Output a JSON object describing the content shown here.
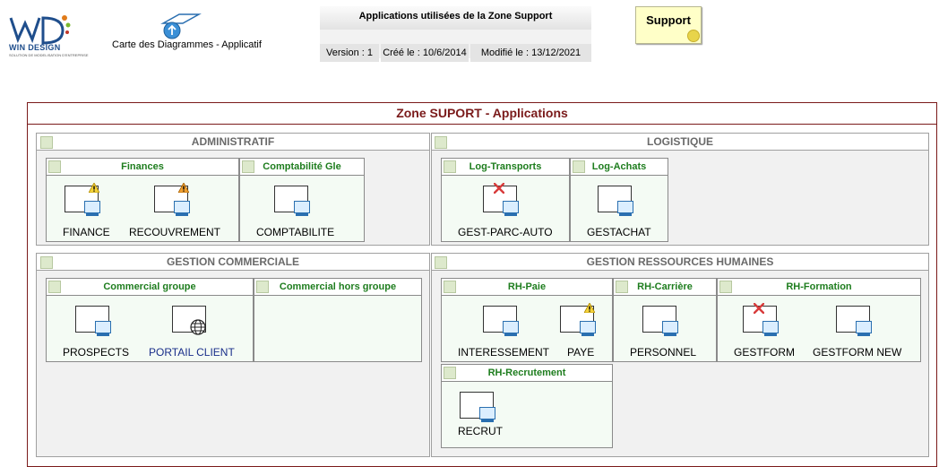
{
  "header": {
    "logo_text": "WIN DESIGN",
    "logo_sub": "SOLUTION DE MODELISATION D'ENTREPRISE",
    "map_label": "Carte des Diagrammes - Applicatif",
    "info_title": "Applications utilisées de la Zone Support",
    "version": "Version : 1",
    "created": "Créé le : 10/6/2014",
    "modified": "Modifié le : 13/12/2021",
    "support_label": "Support"
  },
  "zone": {
    "title": "Zone SUPORT - Applications",
    "groups": {
      "admin": {
        "title": "ADMINISTRATIF"
      },
      "logistique": {
        "title": "LOGISTIQUE"
      },
      "commerciale": {
        "title": "GESTION COMMERCIALE"
      },
      "rh": {
        "title": "GESTION RESSOURCES HUMAINES"
      }
    },
    "subs": {
      "finances": {
        "title": "Finances",
        "apps": [
          "FINANCE",
          "RECOUVREMENT"
        ]
      },
      "compta": {
        "title": "Comptabilité Gle",
        "apps": [
          "COMPTABILITE"
        ]
      },
      "logtransports": {
        "title": "Log-Transports",
        "apps": [
          "GEST-PARC-AUTO"
        ]
      },
      "logachats": {
        "title": "Log-Achats",
        "apps": [
          "GESTACHAT"
        ]
      },
      "comgroupe": {
        "title": "Commercial groupe",
        "apps": [
          "PROSPECTS",
          "PORTAIL CLIENT"
        ]
      },
      "comhors": {
        "title": "Commercial hors groupe"
      },
      "rhpaie": {
        "title": "RH-Paie",
        "apps": [
          "INTERESSEMENT",
          "PAYE"
        ]
      },
      "rhcarriere": {
        "title": "RH-Carrière",
        "apps": [
          "PERSONNEL"
        ]
      },
      "rhformation": {
        "title": "RH-Formation",
        "apps": [
          "GESTFORM",
          "GESTFORM NEW"
        ]
      },
      "rhrecrutement": {
        "title": "RH-Recrutement",
        "apps": [
          "RECRUT"
        ]
      }
    }
  },
  "colors": {
    "zone_border": "#7a1a1a",
    "sub_title": "#1e7d1e",
    "group_title": "#6a6a6a",
    "web_app_label": "#1a2f8a"
  }
}
